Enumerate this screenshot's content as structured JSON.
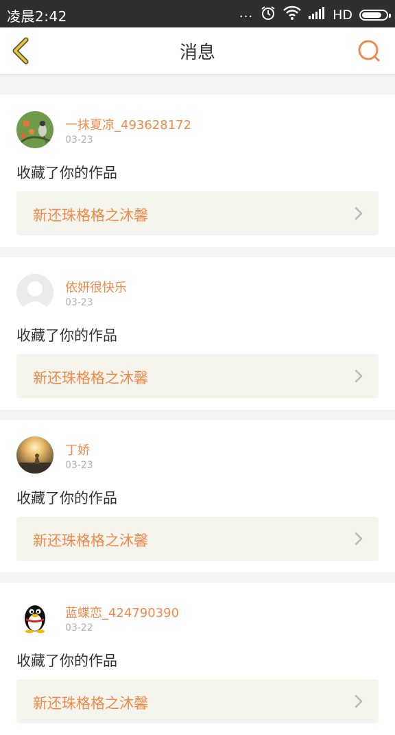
{
  "status_bar": {
    "time": "凌晨2:42",
    "dots": "...",
    "network_type": "HD"
  },
  "header": {
    "title": "消息",
    "back_icon": "chevron-left-icon",
    "search_icon": "search-icon"
  },
  "colors": {
    "accent": "#f08a4b",
    "back_icon": "#e8c33a",
    "status_bar_bg": "#2f2f2f",
    "work_box_bg": "#f4f4ec"
  },
  "messages": [
    {
      "username": "一抹夏凉_493628172",
      "date": "03-23",
      "action": "收藏了你的作品",
      "work_title": "新还珠格格之沐馨",
      "avatar": "bird-photo-avatar"
    },
    {
      "username": "依妍很快乐",
      "date": "03-23",
      "action": "收藏了你的作品",
      "work_title": "新还珠格格之沐馨",
      "avatar": "default-avatar"
    },
    {
      "username": "丁娇",
      "date": "03-23",
      "action": "收藏了你的作品",
      "work_title": "新还珠格格之沐馨",
      "avatar": "sunset-photo-avatar"
    },
    {
      "username": "蓝蝶恋_424790390",
      "date": "03-22",
      "action": "收藏了你的作品",
      "work_title": "新还珠格格之沐馨",
      "avatar": "penguin-avatar"
    }
  ]
}
